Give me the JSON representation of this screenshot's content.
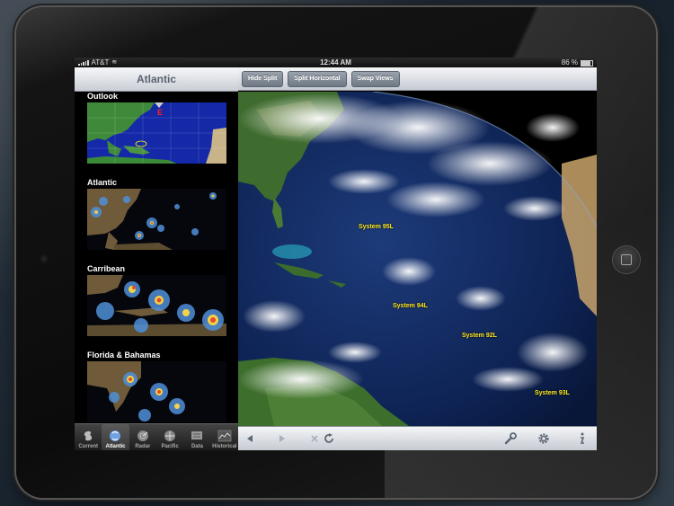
{
  "status_bar": {
    "carrier": "AT&T",
    "time": "12:44 AM",
    "battery": "86 %"
  },
  "left_pane": {
    "title": "Atlantic",
    "items": [
      {
        "label": "Outlook"
      },
      {
        "label": "Atlantic"
      },
      {
        "label": "Carribean"
      },
      {
        "label": "Florida & Bahamas"
      }
    ]
  },
  "tab_bar": {
    "tabs": [
      {
        "label": "Current",
        "icon": "hurricane-icon"
      },
      {
        "label": "Atlantic",
        "icon": "satellite-dish-icon",
        "active": true
      },
      {
        "label": "Radar",
        "icon": "radar-icon"
      },
      {
        "label": "Pacific",
        "icon": "hurricane-symbol-icon"
      },
      {
        "label": "Data",
        "icon": "data-icon"
      },
      {
        "label": "Historical",
        "icon": "chart-icon"
      }
    ]
  },
  "toolbar": {
    "hide_split": "Hide Split",
    "split_horizontal": "Split Horizontal",
    "swap_views": "Swap Views"
  },
  "map": {
    "systems": [
      {
        "label": "System 95L"
      },
      {
        "label": "System 94L"
      },
      {
        "label": "System 92L"
      },
      {
        "label": "System 93L"
      }
    ],
    "label_color": "#ffea1f"
  },
  "bottom_toolbar": {
    "icons": [
      "back-arrow-icon",
      "forward-arrow-icon",
      "stop-icon",
      "refresh-icon",
      "wrench-icon",
      "gear-icon",
      "info-icon"
    ]
  }
}
